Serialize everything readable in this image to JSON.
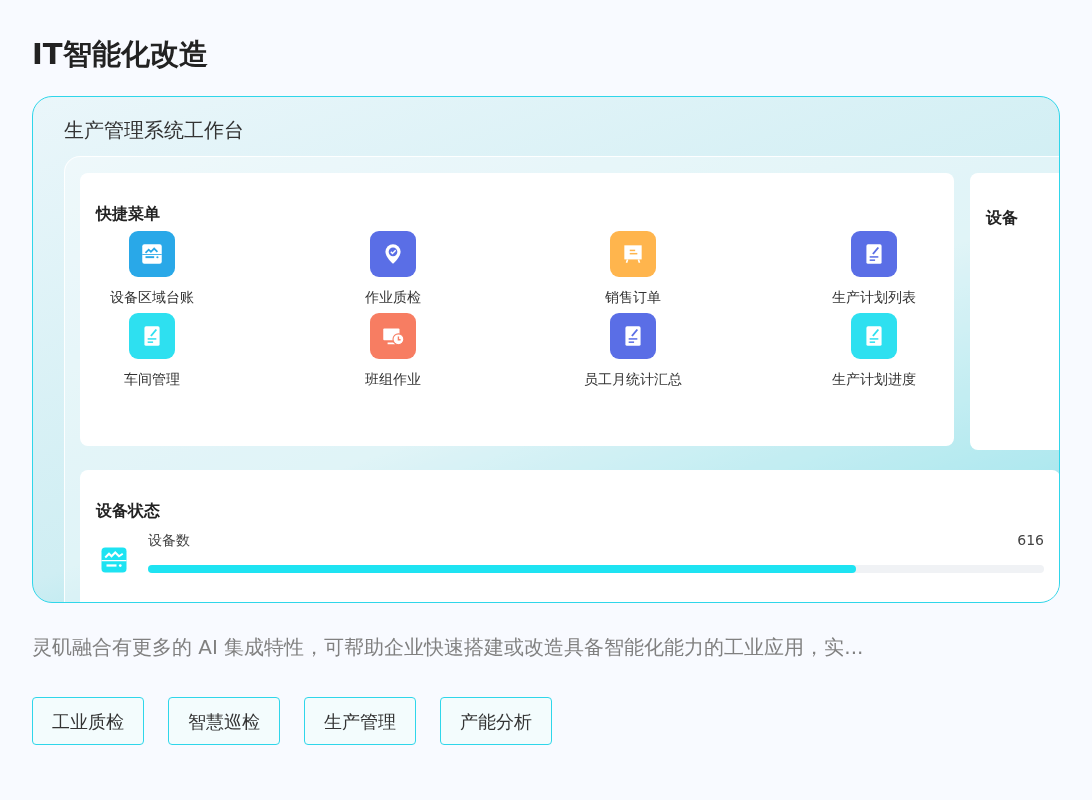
{
  "title": "IT智能化改造",
  "preview": {
    "title": "生产管理系统工作台",
    "quick_menu": {
      "title": "快捷菜单",
      "items": [
        {
          "label": "设备区域台账",
          "kind": "equipment",
          "color": "#29a8e8"
        },
        {
          "label": "作业质检",
          "kind": "location",
          "color": "#5a6ee6"
        },
        {
          "label": "销售订单",
          "kind": "board",
          "color": "#ffb54d"
        },
        {
          "label": "生产计划列表",
          "kind": "doc",
          "color": "#5a6ee6"
        },
        {
          "label": "车间管理",
          "kind": "doc",
          "color": "#2ee0f0"
        },
        {
          "label": "班组作业",
          "kind": "monitor",
          "color": "#f77d62"
        },
        {
          "label": "员工月统计汇总",
          "kind": "doc",
          "color": "#5a6ee6"
        },
        {
          "label": "生产计划进度",
          "kind": "doc",
          "color": "#2ee0f0"
        }
      ]
    },
    "side_card": {
      "title": "设备"
    },
    "device_status": {
      "title": "设备状态",
      "metrics": [
        {
          "label": "设备数",
          "value": "616",
          "level": 0.79
        }
      ]
    }
  },
  "description": "灵矶融合有更多的 AI 集成特性，可帮助企业快速搭建或改造具备智能化能力的工业应用，实...",
  "tags": [
    "工业质检",
    "智慧巡检",
    "生产管理",
    "产能分析"
  ]
}
